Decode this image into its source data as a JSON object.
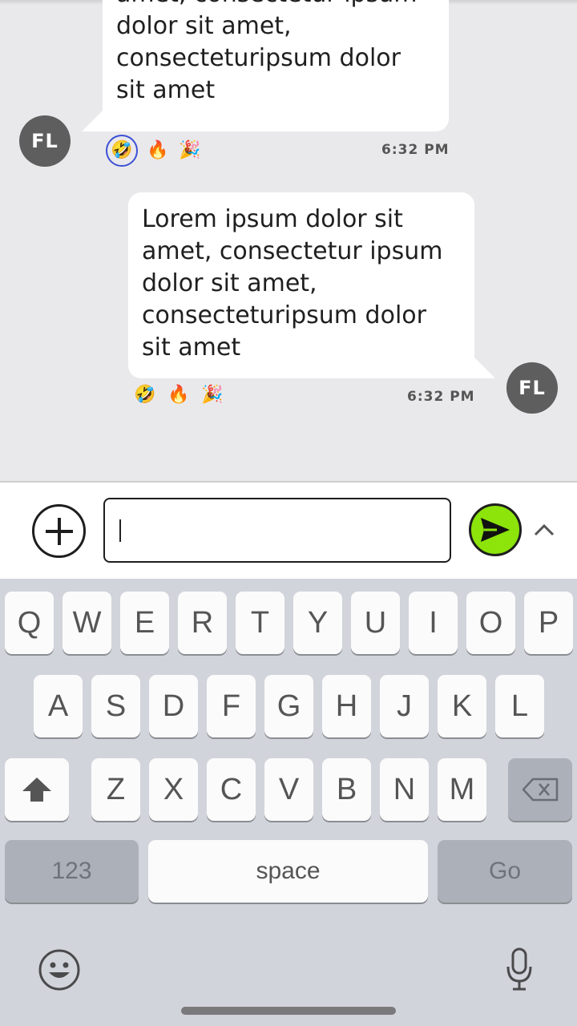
{
  "messages": [
    {
      "direction": "incoming",
      "avatar_initials": "FL",
      "text": "amet, consectetur ipsum\ndolor sit amet,\nconsecteturipsum dolor\nsit amet",
      "reactions": [
        "🤣",
        "🔥",
        "🎉"
      ],
      "selected_reaction": "🤣",
      "time": "6:32 PM"
    },
    {
      "direction": "outgoing",
      "avatar_initials": "FL",
      "text": "Lorem ipsum dolor sit\namet, consectetur ipsum\ndolor sit amet,\nconsecteturipsum dolor\nsit amet",
      "reactions": [
        "🤣",
        "🔥",
        "🎉"
      ],
      "time": "6:32 PM"
    }
  ],
  "composer": {
    "input_value": "",
    "add_icon": "plus-circle-icon",
    "send_icon": "send-arrow-icon",
    "expand_icon": "chevron-up-icon",
    "send_color": "#8ce40b"
  },
  "keyboard": {
    "row1": [
      "Q",
      "W",
      "E",
      "R",
      "T",
      "Y",
      "U",
      "I",
      "O",
      "P"
    ],
    "row2": [
      "A",
      "S",
      "D",
      "F",
      "G",
      "H",
      "J",
      "K",
      "L"
    ],
    "row3": [
      "Z",
      "X",
      "C",
      "V",
      "B",
      "N",
      "M"
    ],
    "numbers_label": "123",
    "space_label": "space",
    "go_label": "Go",
    "shift_icon": "shift-icon",
    "delete_icon": "backspace-icon",
    "emoji_icon": "emoji-icon",
    "mic_icon": "microphone-icon"
  }
}
